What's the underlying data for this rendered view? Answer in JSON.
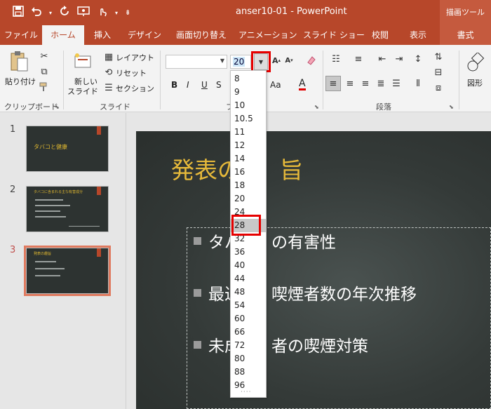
{
  "window": {
    "title": "anser10-01 - PowerPoint",
    "context_tool": "描画ツール"
  },
  "qat": {
    "save_icon": "save-icon",
    "undo_icon": "undo-icon",
    "redo_icon": "redo-icon",
    "present_icon": "present-icon",
    "touch_icon": "touch-icon",
    "customize_icon": "customize-icon"
  },
  "tabs": [
    {
      "label": "ファイル"
    },
    {
      "label": "ホーム",
      "active": true
    },
    {
      "label": "挿入"
    },
    {
      "label": "デザイン"
    },
    {
      "label": "画面切り替え"
    },
    {
      "label": "アニメーション"
    },
    {
      "label": "スライド ショー"
    },
    {
      "label": "校閲"
    },
    {
      "label": "表示"
    },
    {
      "label": "書式"
    }
  ],
  "ribbon": {
    "clipboard": {
      "paste_label": "貼り付け",
      "group_label": "クリップボード"
    },
    "slides": {
      "new_slide_line1": "新しい",
      "new_slide_line2": "スライド",
      "layout_label": "レイアウト",
      "reset_label": "リセット",
      "section_label": "セクション",
      "group_label": "スライド"
    },
    "font": {
      "group_label": "フ",
      "font_name": "",
      "font_size": "20",
      "bold": "B",
      "italic": "I",
      "underline": "U",
      "shadow": "S",
      "change_case": "Aa",
      "font_color": "A"
    },
    "paragraph": {
      "group_label": "段落"
    },
    "drawing": {
      "shape_label": "図形"
    }
  },
  "slides_panel": [
    {
      "number": "1",
      "title": "タバコと健康"
    },
    {
      "number": "2",
      "title": "タバコに含まれる主な有害成分"
    },
    {
      "number": "3",
      "title": "発表の趣旨",
      "active": true
    }
  ],
  "slide": {
    "title": "発表の趣旨",
    "title_visible": "発表の",
    "title_tail": "旨",
    "bullets": [
      {
        "prefix": "タバ",
        "suffix": "の有害性"
      },
      {
        "prefix": "最近",
        "suffix": "喫煙者数の年次推移"
      },
      {
        "prefix": "未成",
        "suffix": "者の喫煙対策"
      }
    ]
  },
  "font_size_dropdown": {
    "options": [
      "8",
      "9",
      "10",
      "10.5",
      "11",
      "12",
      "14",
      "16",
      "18",
      "20",
      "24",
      "28",
      "32",
      "36",
      "40",
      "44",
      "48",
      "54",
      "60",
      "66",
      "72",
      "80",
      "88",
      "96"
    ],
    "highlighted": "28"
  }
}
